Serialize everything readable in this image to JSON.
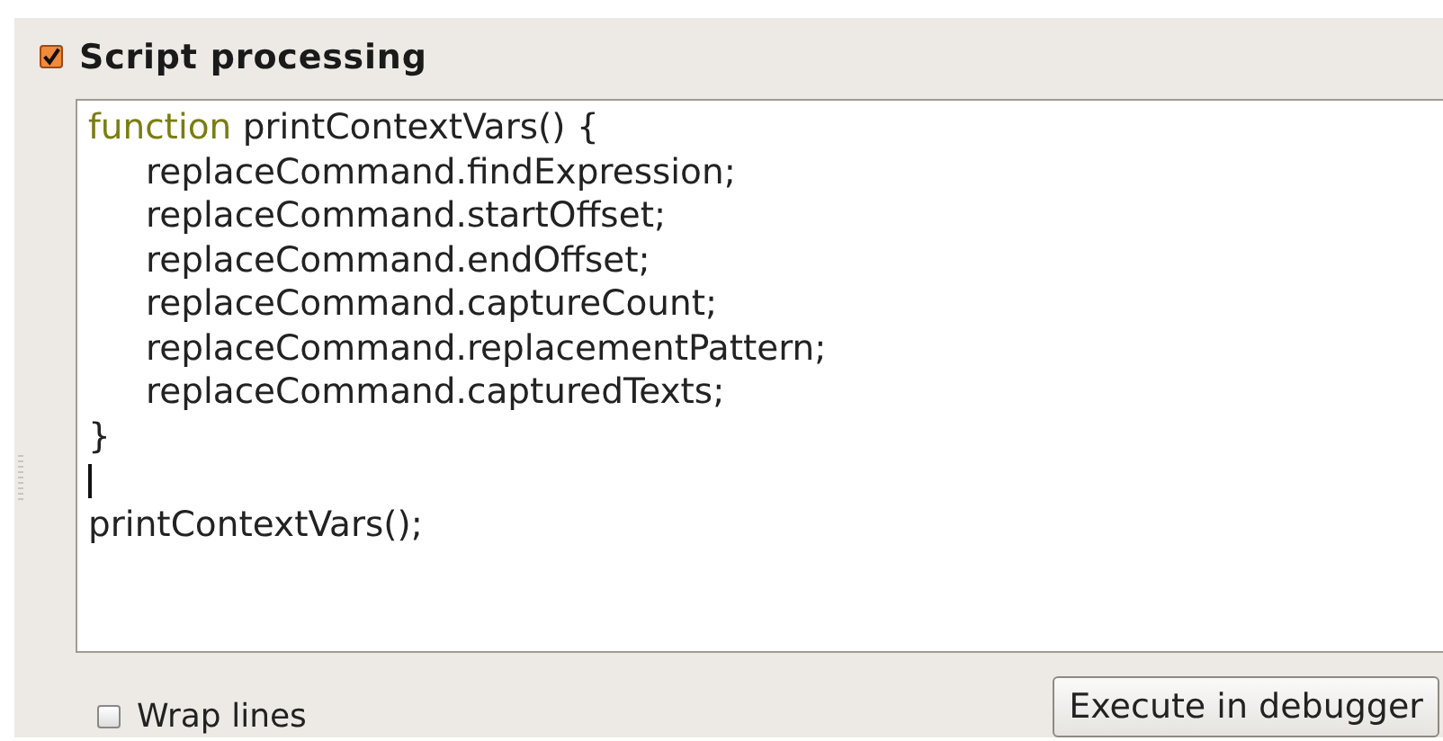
{
  "section": {
    "title": "Script processing",
    "checked": true
  },
  "editor": {
    "lines": [
      {
        "kind": "keyword",
        "keyword": "function",
        "text": "printContextVars() {",
        "indented": false
      },
      {
        "kind": "code",
        "text": "replaceCommand.findExpression;",
        "indented": true
      },
      {
        "kind": "code",
        "text": "replaceCommand.startOffset;",
        "indented": true
      },
      {
        "kind": "code",
        "text": "replaceCommand.endOffset;",
        "indented": true
      },
      {
        "kind": "code",
        "text": "replaceCommand.captureCount;",
        "indented": true
      },
      {
        "kind": "code",
        "text": "replaceCommand.replacementPattern;",
        "indented": true
      },
      {
        "kind": "code",
        "text": "replaceCommand.capturedTexts;",
        "indented": true
      },
      {
        "kind": "code",
        "text": "}",
        "indented": false
      },
      {
        "kind": "cursor"
      },
      {
        "kind": "code",
        "text": "printContextVars();",
        "indented": false
      }
    ]
  },
  "wrap_lines": {
    "label": "Wrap lines",
    "checked": false
  },
  "buttons": [
    "Execute in debugger"
  ]
}
